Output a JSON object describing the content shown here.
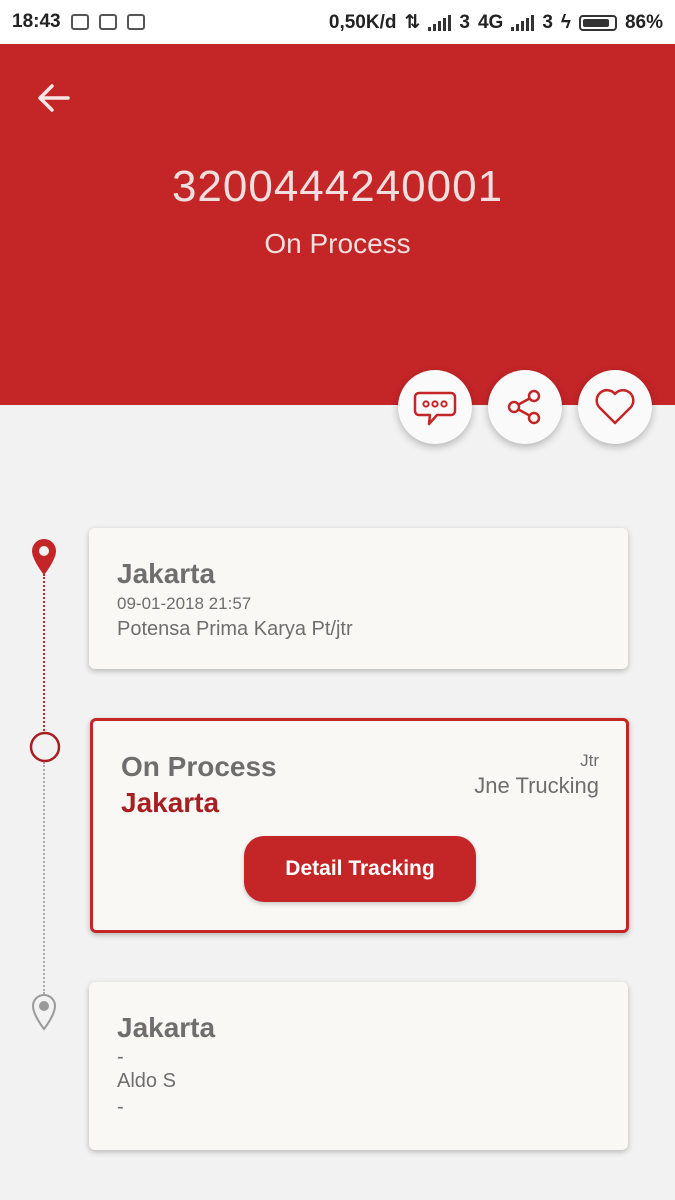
{
  "status_bar": {
    "time": "18:43",
    "net_speed": "0,50K/d",
    "sim1_label": "3",
    "network_type": "4G",
    "sim2_label": "3",
    "battery": "86%"
  },
  "header": {
    "tracking_number": "3200444240001",
    "status": "On Process"
  },
  "actions": {
    "chat_icon": "chat-bubble-icon",
    "share_icon": "share-icon",
    "favorite_icon": "heart-icon"
  },
  "timeline": {
    "origin": {
      "city": "Jakarta",
      "datetime": "09-01-2018 21:57",
      "sender": "Potensa Prima Karya Pt/jtr"
    },
    "current": {
      "status": "On Process",
      "city": "Jakarta",
      "code": "Jtr",
      "carrier": "Jne Trucking",
      "button_label": "Detail Tracking"
    },
    "destination": {
      "city": "Jakarta",
      "line1": "-",
      "receiver": "Aldo S",
      "line3": "-"
    }
  },
  "colors": {
    "primary": "#c42527",
    "text_grey": "#6e6e6e",
    "background": "#f2f2f2",
    "card": "#f9f8f5"
  }
}
